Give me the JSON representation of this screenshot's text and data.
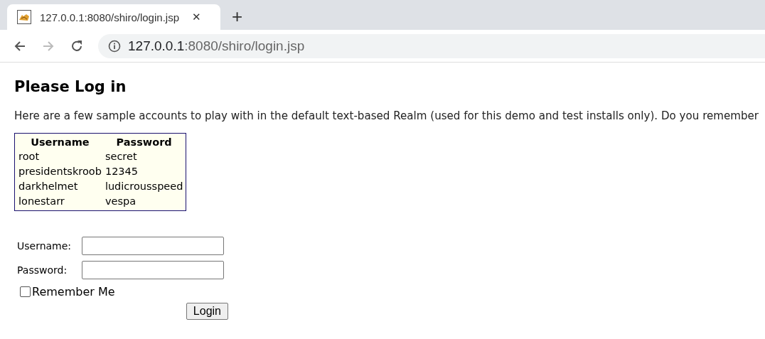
{
  "browser": {
    "tab": {
      "title": "127.0.0.1:8080/shiro/login.jsp",
      "close": "✕"
    },
    "new_tab": "+",
    "address": {
      "host": "127.0.0.1",
      "path": ":8080/shiro/login.jsp"
    }
  },
  "page": {
    "heading": "Please Log in",
    "intro": "Here are a few sample accounts to play with in the default text-based Realm (used for this demo and test installs only). Do you remember",
    "accounts": {
      "columns": [
        "Username",
        "Password"
      ],
      "rows": [
        [
          "root",
          "secret"
        ],
        [
          "presidentskroob",
          "12345"
        ],
        [
          "darkhelmet",
          "ludicrousspeed"
        ],
        [
          "lonestarr",
          "vespa"
        ]
      ]
    },
    "form": {
      "fields": [
        {
          "label": "Username:"
        },
        {
          "label": "Password:"
        }
      ],
      "remember_me": {
        "label": "Remember Me",
        "checked": false
      },
      "submit": "Login"
    }
  }
}
